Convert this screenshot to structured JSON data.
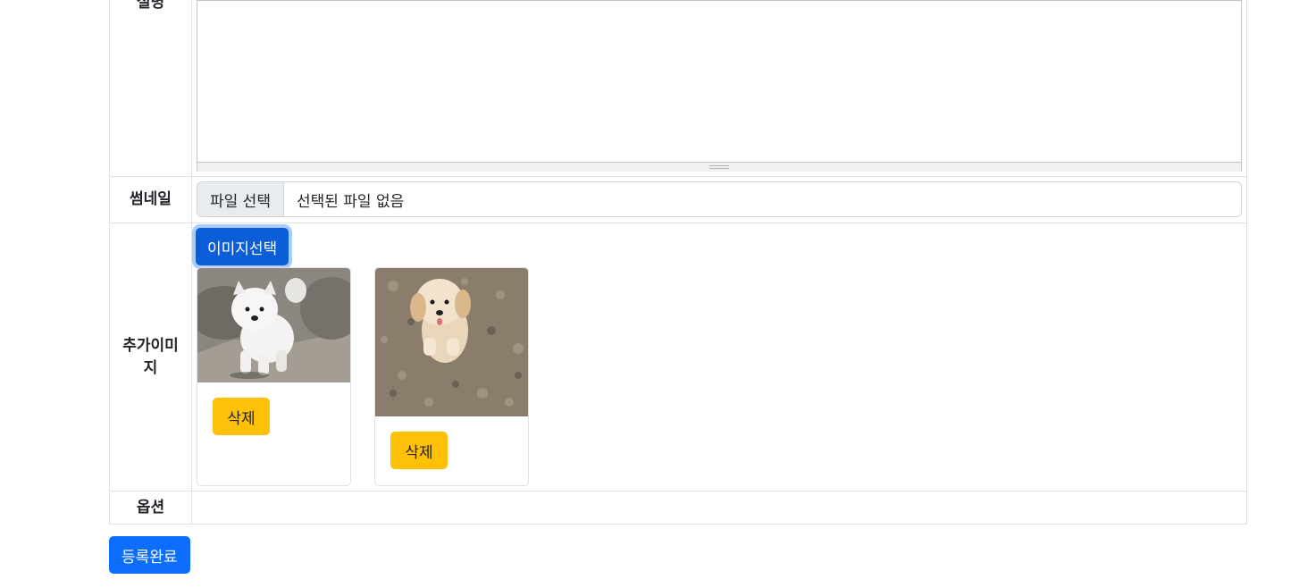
{
  "form": {
    "description_label": "설명",
    "thumbnail_label": "썸네일",
    "file_button_label": "파일 선택",
    "file_status": "선택된 파일 없음",
    "extra_images_label": "추가이미지",
    "select_images_button": "이미지선택",
    "images": [
      {
        "icon": "white-puppy-photo",
        "delete_label": "삭제"
      },
      {
        "icon": "cream-puppy-photo",
        "delete_label": "삭제"
      }
    ],
    "option_label": "옵션"
  },
  "submit_label": "등록완료",
  "colors": {
    "primary": "#0d6efd",
    "primary_active": "#0b5ed7",
    "warning": "#ffc107",
    "border": "#dee2e6"
  }
}
